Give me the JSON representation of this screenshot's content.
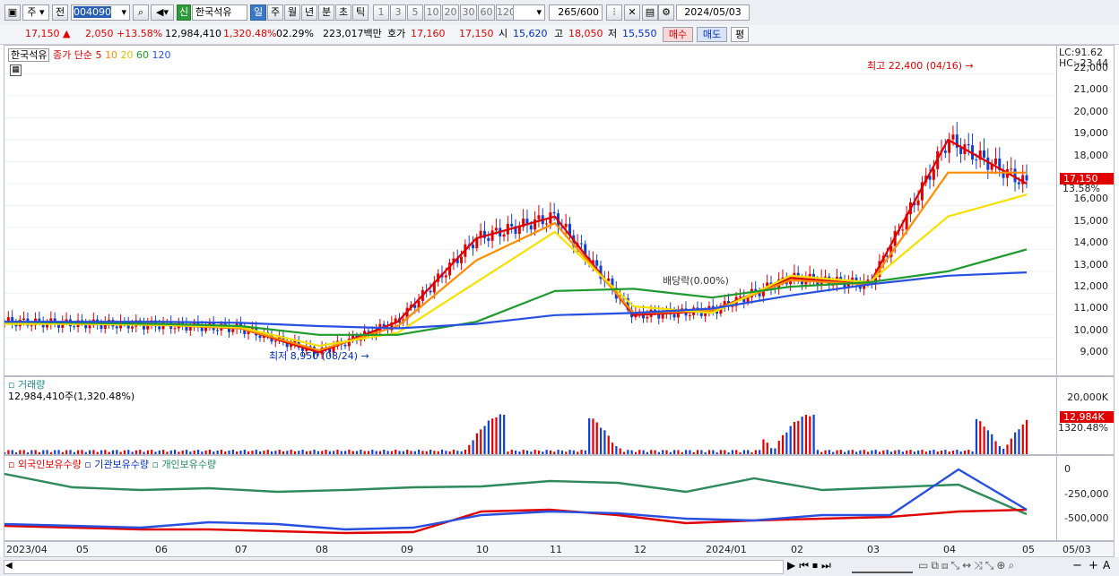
{
  "toolbar": {
    "market": "주",
    "prev_label": "전",
    "code": "004090",
    "new_badge": "신",
    "stock_name": "한국석유",
    "periods": [
      "일",
      "주",
      "월",
      "년",
      "분",
      "초",
      "틱"
    ],
    "active_period": "일",
    "intervals": [
      "1",
      "3",
      "5",
      "10",
      "20",
      "30",
      "60",
      "120"
    ],
    "count": "265",
    "count_total": "/600",
    "date": "2024/05/03"
  },
  "quote": {
    "price": "17,150",
    "change": "2,050",
    "change_pct": "+13.58%",
    "volume": "12,984,410",
    "volume_pct": "1,320.48%",
    "turnover": "02.29%",
    "amount": "223,017백만",
    "bid_label": "호가",
    "bid": "17,160",
    "ask": "17,150",
    "open_label": "시",
    "open": "15,620",
    "high_label": "고",
    "high": "18,050",
    "low_label": "저",
    "low": "15,550",
    "buy_btn": "매수",
    "sell_btn": "매도",
    "eval_btn": "평"
  },
  "price_panel": {
    "legend_name": "한국석유",
    "legend_ma": "종가 단순",
    "ma_periods": [
      "5",
      "10",
      "20",
      "60",
      "120"
    ],
    "lc": "LC:91.62",
    "hc": "HC:-23.44",
    "current_tag": "17,150",
    "current_pct": "13.58%",
    "high_note": "최고 22,400 (04/16)",
    "low_note": "최저 8,950 (08/24)",
    "dividend_note": "배당락(0.00%)",
    "y_ticks": [
      "22,000",
      "21,000",
      "20,000",
      "19,000",
      "18,000",
      "17,000",
      "16,000",
      "15,000",
      "14,000",
      "13,000",
      "12,000",
      "11,000",
      "10,000",
      "9,000"
    ]
  },
  "volume_panel": {
    "legend": "거래량",
    "value": "12,984,410주(1,320.48%)",
    "y_tick": "20,000K",
    "current_tag": "12,984K",
    "current_pct": "1320.48%"
  },
  "holding_panel": {
    "legend_foreign": "외국인보유수량",
    "legend_inst": "기관보유수량",
    "legend_indiv": "개인보유수량",
    "y_ticks": [
      "0",
      "-250,000",
      "-500,000"
    ]
  },
  "x_axis": [
    "2023/04",
    "05",
    "06",
    "07",
    "08",
    "09",
    "10",
    "11",
    "12",
    "2024/01",
    "02",
    "03",
    "04",
    "05",
    "05/03"
  ],
  "colors": {
    "ma5": "#e00000",
    "ma10": "#ff8c00",
    "ma20": "#f5e000",
    "ma60": "#1e9a2e",
    "ma120": "#2850e0",
    "up": "#e00000",
    "down": "#1040d0"
  },
  "chart_data": {
    "type": "line",
    "note_dates": {
      "high": "04/16",
      "low": "08/24"
    },
    "x": [
      "2023/04",
      "05",
      "06",
      "07",
      "08",
      "09",
      "10",
      "11",
      "12",
      "2024/01",
      "02",
      "03",
      "04",
      "05"
    ],
    "series": [
      {
        "name": "5",
        "values": [
          10700,
          10600,
          10550,
          10400,
          9300,
          10700,
          14500,
          15500,
          11000,
          11200,
          12700,
          12400,
          19000,
          17000
        ]
      },
      {
        "name": "10",
        "values": [
          10650,
          10600,
          10550,
          10400,
          9400,
          10500,
          13500,
          15200,
          11100,
          11200,
          12600,
          12400,
          17500,
          17500
        ]
      },
      {
        "name": "20",
        "values": [
          10600,
          10600,
          10550,
          10450,
          9600,
          10200,
          12500,
          14800,
          11400,
          11100,
          12800,
          12500,
          15500,
          16500
        ]
      },
      {
        "name": "60",
        "values": [
          10700,
          10650,
          10600,
          10500,
          10100,
          10100,
          10700,
          12100,
          12200,
          11800,
          12300,
          12500,
          13000,
          14000
        ]
      },
      {
        "name": "120",
        "values": [
          10700,
          10700,
          10700,
          10650,
          10500,
          10400,
          10600,
          11000,
          11100,
          11300,
          11900,
          12400,
          12800,
          12950
        ]
      }
    ],
    "ylim": [
      8500,
      22800
    ]
  }
}
